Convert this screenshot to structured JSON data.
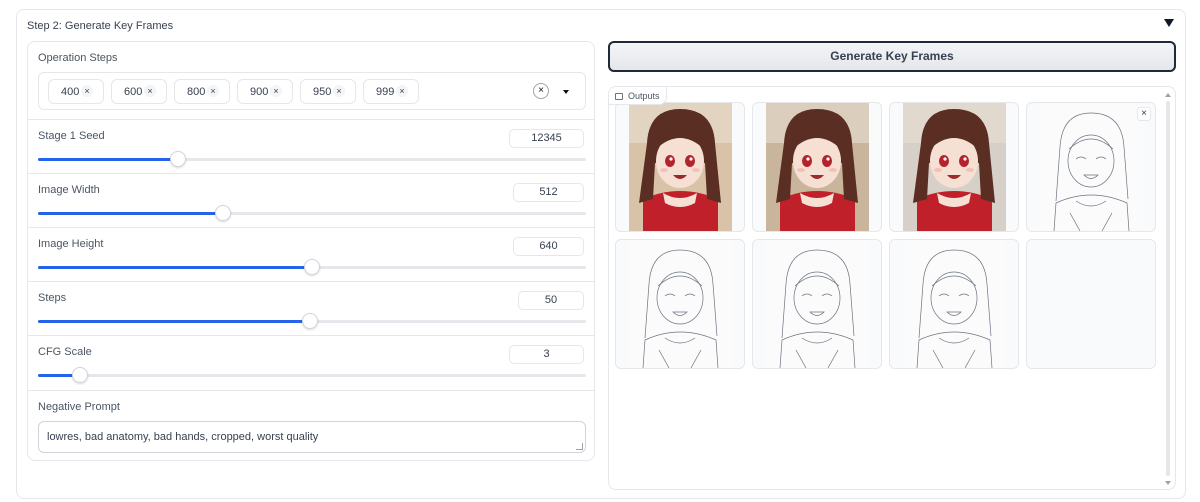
{
  "accordion": {
    "title": "Step 2: Generate Key Frames"
  },
  "operation_steps": {
    "label": "Operation Steps",
    "tokens": [
      "400",
      "600",
      "800",
      "900",
      "950",
      "999"
    ],
    "remove_glyph": "×",
    "clear_glyph": "×"
  },
  "sliders": [
    {
      "label": "Stage 1 Seed",
      "value": "12345",
      "fraction": 0.255
    },
    {
      "label": "Image Width",
      "value": "512",
      "fraction": 0.338
    },
    {
      "label": "Image Height",
      "value": "640",
      "fraction": 0.5
    },
    {
      "label": "Steps",
      "value": "50",
      "fraction": 0.497
    },
    {
      "label": "CFG Scale",
      "value": "3",
      "fraction": 0.077
    }
  ],
  "negative_prompt": {
    "label": "Negative Prompt",
    "value": "lowres, bad anatomy, bad hands, cropped, worst quality"
  },
  "generate_button": {
    "label": "Generate Key Frames"
  },
  "outputs": {
    "label": "Outputs",
    "close_glyph": "×",
    "items": [
      {
        "kind": "color-photo"
      },
      {
        "kind": "color-photo"
      },
      {
        "kind": "color-photo"
      },
      {
        "kind": "sketch"
      },
      {
        "kind": "sketch"
      },
      {
        "kind": "sketch"
      },
      {
        "kind": "sketch"
      },
      {
        "kind": "blank"
      }
    ]
  },
  "colors": {
    "accent": "#2563eb",
    "border": "#e5e7eb",
    "button_border": "#1f2937",
    "outfit_red": "#c0202a",
    "hair_brown": "#5a2e22",
    "skin": "#f6dfd3"
  }
}
